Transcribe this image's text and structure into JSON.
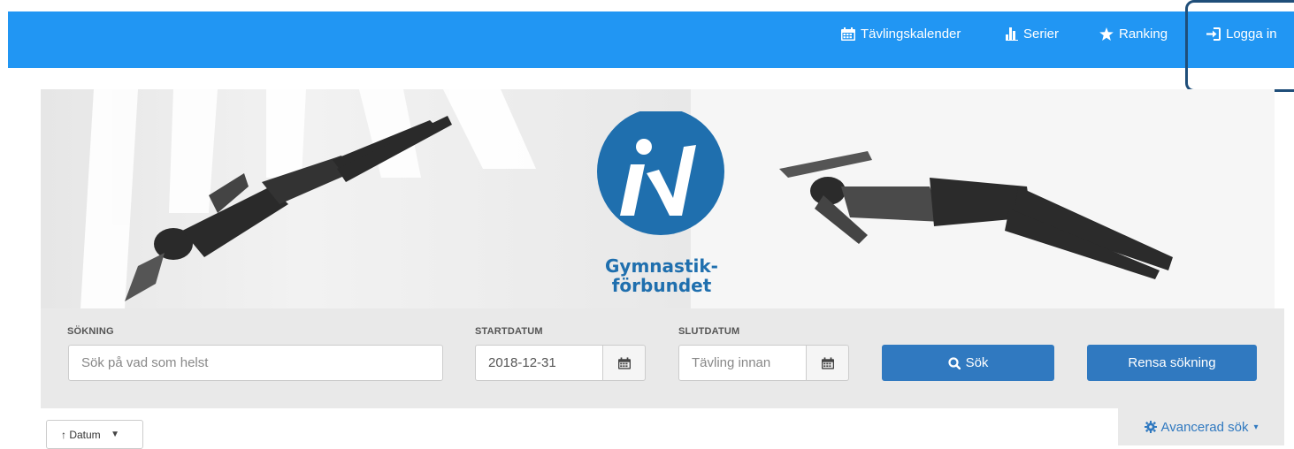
{
  "nav": {
    "items": [
      {
        "label": "Tävlingskalender",
        "icon": "calendar-icon"
      },
      {
        "label": "Serier",
        "icon": "bar-chart-icon"
      },
      {
        "label": "Ranking",
        "icon": "star-icon"
      },
      {
        "label": "Logga in",
        "icon": "sign-in-icon"
      }
    ],
    "color": "#2196f3"
  },
  "hero": {
    "logo_line1": "Gymnastik-",
    "logo_line2": "förbundet",
    "logo_color": "#1f6fae"
  },
  "search": {
    "label_search": "SÖKNING",
    "label_start": "STARTDATUM",
    "label_end": "SLUTDATUM",
    "search_placeholder": "Sök på vad som helst",
    "start_value": "2018-12-31",
    "end_placeholder": "Tävling innan",
    "search_button": "Sök",
    "clear_button": "Rensa sökning",
    "button_color": "#3079c0"
  },
  "sort": {
    "selected": "↑ Datum",
    "caret": "▼"
  },
  "advanced": {
    "label": "Avancerad sök",
    "caret": "▾"
  }
}
